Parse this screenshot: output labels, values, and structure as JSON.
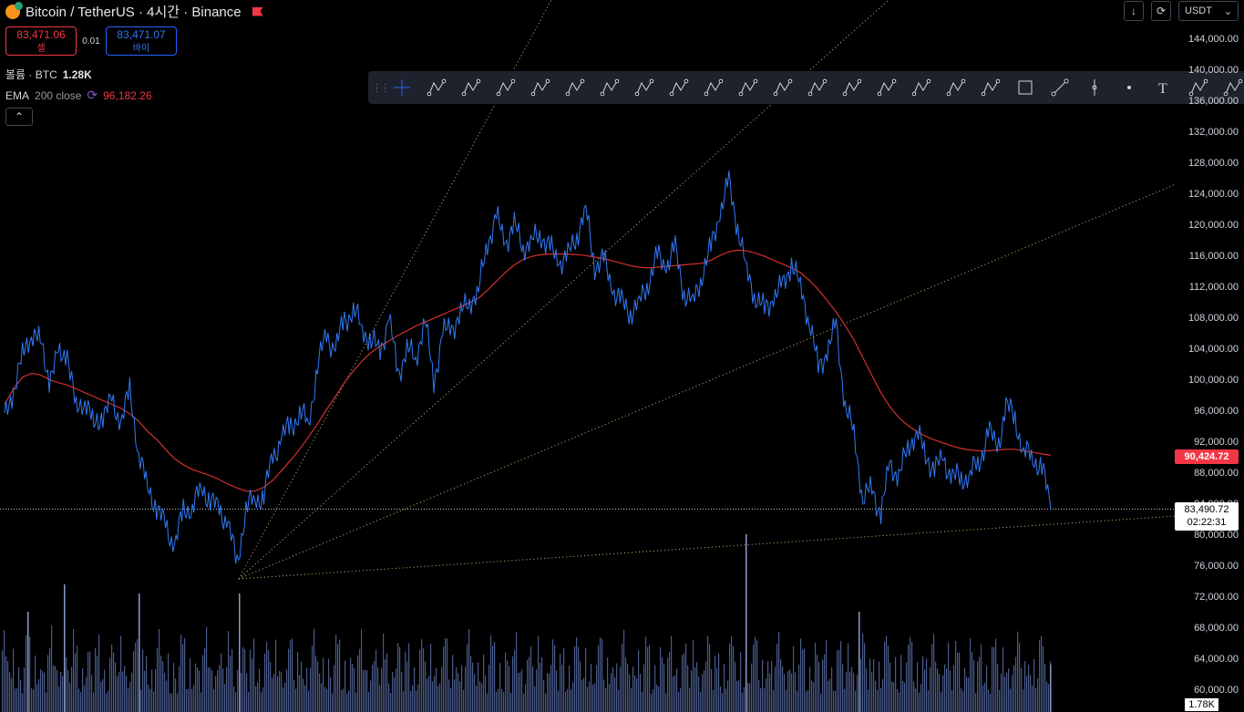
{
  "header": {
    "symbol_title": "Bitcoin / TetherUS · 4시간 · Binance"
  },
  "trade": {
    "sell_price": "83,471.06",
    "sell_label": "셀",
    "spread": "0.01",
    "buy_price": "83,471.07",
    "buy_label": "바이"
  },
  "volume": {
    "label": "볼륨 · BTC",
    "value": "1.28K"
  },
  "ema": {
    "name": "EMA",
    "params": "200 close",
    "value": "96,182.26",
    "icon": "refresh-icon"
  },
  "top_right": {
    "currency": "USDT"
  },
  "price_axis": {
    "labels": [
      "144,000.00",
      "140,000.00",
      "136,000.00",
      "132,000.00",
      "128,000.00",
      "124,000.00",
      "120,000.00",
      "116,000.00",
      "112,000.00",
      "108,000.00",
      "104,000.00",
      "100,000.00",
      "96,000.00",
      "92,000.00",
      "88,000.00",
      "84,000.00",
      "80,000.00",
      "76,000.00",
      "72,000.00",
      "68,000.00",
      "64,000.00",
      "60,000.00"
    ],
    "ema_tag": "90,424.72",
    "current_price": "83,490.72",
    "countdown": "02:22:31",
    "volume_tag": "1.78K"
  },
  "colors": {
    "price_line": "#3179f5",
    "ema_line": "#d32f2f",
    "fan_line": "#c8c07a",
    "volume_bar": "#4a5a8a",
    "ema_tag_bg": "#f23645"
  },
  "toolbar": {
    "tools": [
      "crosshair-icon",
      "pitchfork-icon",
      "trend-line-icon",
      "parallel-channel-icon",
      "regression-trend-icon",
      "fib-retracement-icon",
      "xabcd-pattern-icon",
      "abcd-pattern-icon",
      "ac-pattern-icon",
      "wz-wave-icon",
      "15-wave-icon",
      "wy-wave-icon",
      "ray-icon",
      "gann-box-icon",
      "flag-icon",
      "head-shoulders-icon",
      "triangle-pattern-icon",
      "three-drives-icon",
      "rectangle-icon",
      "line-icon",
      "vertical-line-icon",
      "dot-icon",
      "text-icon",
      "fib-grid-icon",
      "angle-icon"
    ]
  },
  "chart_data": {
    "type": "line",
    "ylim": [
      56000,
      146000
    ],
    "price": [
      95000,
      99000,
      103000,
      106500,
      105000,
      100500,
      103000,
      104000,
      96000,
      98000,
      94000,
      96000,
      97000,
      95000,
      98500,
      91000,
      86000,
      84000,
      81000,
      79000,
      83000,
      84000,
      86000,
      85000,
      83000,
      82000,
      76000,
      84000,
      84500,
      85500,
      90000,
      93000,
      94000,
      96000,
      94500,
      102000,
      106000,
      104000,
      108000,
      109000,
      107000,
      105000,
      104000,
      108000,
      101000,
      104000,
      103000,
      108000,
      100000,
      106000,
      107000,
      108500,
      110500,
      111500,
      118000,
      121000,
      118000,
      120000,
      117500,
      118000,
      119000,
      117000,
      115500,
      116000,
      119000,
      122000,
      115000,
      115500,
      112000,
      110000,
      109000,
      110000,
      113000,
      116000,
      115000,
      117000,
      111500,
      110000,
      114000,
      117000,
      122000,
      125500,
      120000,
      114000,
      111000,
      109000,
      111000,
      112000,
      115500,
      112000,
      108000,
      101500,
      104000,
      107000,
      97000,
      93000,
      85000,
      86000,
      83000,
      89000,
      88000,
      91000,
      94000,
      90000,
      89000,
      89500,
      88000,
      87000,
      88500,
      89000,
      94000,
      91000,
      97000,
      95000,
      91000,
      90000,
      89000,
      83500
    ],
    "ema200": [
      97000,
      99000,
      100500,
      101000,
      100800,
      100200,
      99800,
      99500,
      99000,
      98500,
      98000,
      97500,
      97000,
      96500,
      95800,
      94800,
      93500,
      92500,
      91200,
      90000,
      89200,
      88600,
      88200,
      87800,
      87300,
      86700,
      86200,
      85800,
      85800,
      86300,
      87200,
      88500,
      89800,
      91200,
      92800,
      94500,
      96300,
      98000,
      99800,
      101300,
      102600,
      103700,
      104500,
      105200,
      105900,
      106500,
      107100,
      107600,
      108100,
      108600,
      109100,
      109600,
      110100,
      110700,
      111700,
      112900,
      114000,
      115000,
      115700,
      116100,
      116300,
      116400,
      116400,
      116400,
      116300,
      116200,
      116000,
      115800,
      115500,
      115200,
      114900,
      114700,
      114600,
      114700,
      114800,
      114900,
      115000,
      115100,
      115200,
      115600,
      116200,
      116700,
      116900,
      116800,
      116500,
      116100,
      115600,
      115100,
      114600,
      114000,
      113000,
      111800,
      110400,
      108900,
      107200,
      105300,
      103000,
      100700,
      98500,
      96700,
      95300,
      94300,
      93500,
      92900,
      92400,
      92000,
      91600,
      91300,
      91100,
      91000,
      91000,
      91100,
      91200,
      91200,
      91000,
      90800,
      90600,
      90424.72
    ],
    "fan_lines": [
      "fan-ray-1",
      "fan-ray-2",
      "fan-ray-3",
      "fan-ray-4"
    ]
  }
}
